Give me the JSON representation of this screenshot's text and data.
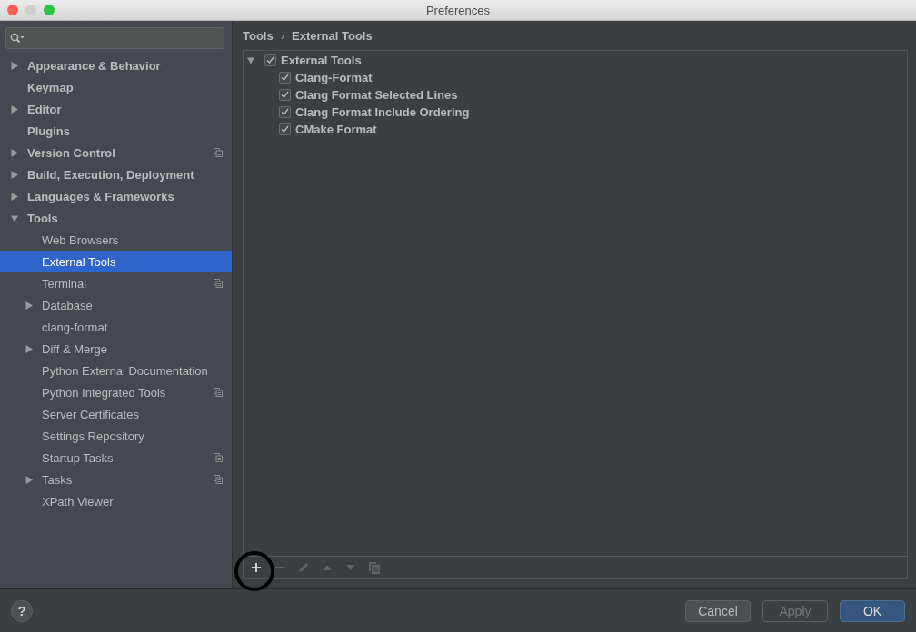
{
  "window": {
    "title": "Preferences"
  },
  "sidebar": {
    "items": [
      {
        "label": "Appearance & Behavior",
        "expanded": false,
        "selected": false,
        "project_scope": false
      },
      {
        "label": "Keymap",
        "selected": false,
        "project_scope": false
      },
      {
        "label": "Editor",
        "expanded": false,
        "selected": false,
        "project_scope": false
      },
      {
        "label": "Plugins",
        "selected": false,
        "project_scope": false
      },
      {
        "label": "Version Control",
        "expanded": false,
        "selected": false,
        "project_scope": true
      },
      {
        "label": "Build, Execution, Deployment",
        "expanded": false,
        "selected": false,
        "project_scope": false
      },
      {
        "label": "Languages & Frameworks",
        "expanded": false,
        "selected": false,
        "project_scope": false
      },
      {
        "label": "Tools",
        "expanded": true,
        "selected": false,
        "project_scope": false,
        "children": [
          {
            "label": "Web Browsers",
            "selected": false,
            "project_scope": false
          },
          {
            "label": "External Tools",
            "selected": true,
            "project_scope": false
          },
          {
            "label": "Terminal",
            "selected": false,
            "project_scope": true
          },
          {
            "label": "Database",
            "expanded": false,
            "selected": false,
            "project_scope": false
          },
          {
            "label": "clang-format",
            "selected": false,
            "project_scope": false
          },
          {
            "label": "Diff & Merge",
            "expanded": false,
            "selected": false,
            "project_scope": false
          },
          {
            "label": "Python External Documentation",
            "selected": false,
            "project_scope": false
          },
          {
            "label": "Python Integrated Tools",
            "selected": false,
            "project_scope": true
          },
          {
            "label": "Server Certificates",
            "selected": false,
            "project_scope": false
          },
          {
            "label": "Settings Repository",
            "selected": false,
            "project_scope": false
          },
          {
            "label": "Startup Tasks",
            "selected": false,
            "project_scope": true
          },
          {
            "label": "Tasks",
            "expanded": false,
            "selected": false,
            "project_scope": true
          },
          {
            "label": "XPath Viewer",
            "selected": false,
            "project_scope": false
          }
        ]
      }
    ]
  },
  "breadcrumb": [
    "Tools",
    "›",
    "External Tools"
  ],
  "tool_tree": [
    {
      "label": "External Tools",
      "expanded": true,
      "checked": true,
      "children": [
        {
          "label": "Clang-Format",
          "checked": true
        },
        {
          "label": "Clang Format Selected Lines",
          "checked": true
        },
        {
          "label": "Clang Format Include Ordering",
          "checked": true
        },
        {
          "label": "CMake Format",
          "checked": true
        }
      ]
    }
  ],
  "toolbar": [
    {
      "kind": "add",
      "disabled": false,
      "highlighted": true
    },
    {
      "kind": "remove",
      "disabled": true,
      "highlighted": false
    },
    {
      "kind": "edit",
      "disabled": true,
      "highlighted": false
    },
    {
      "kind": "up",
      "disabled": true,
      "highlighted": false
    },
    {
      "kind": "down",
      "disabled": true,
      "highlighted": false
    },
    {
      "kind": "copy",
      "disabled": true,
      "highlighted": false
    }
  ],
  "footer": {
    "help": "?",
    "buttons": [
      {
        "label": "Cancel",
        "kind": "normal",
        "disabled": false
      },
      {
        "label": "Apply",
        "kind": "normal",
        "disabled": true
      },
      {
        "label": "OK",
        "kind": "default",
        "disabled": false
      }
    ]
  }
}
